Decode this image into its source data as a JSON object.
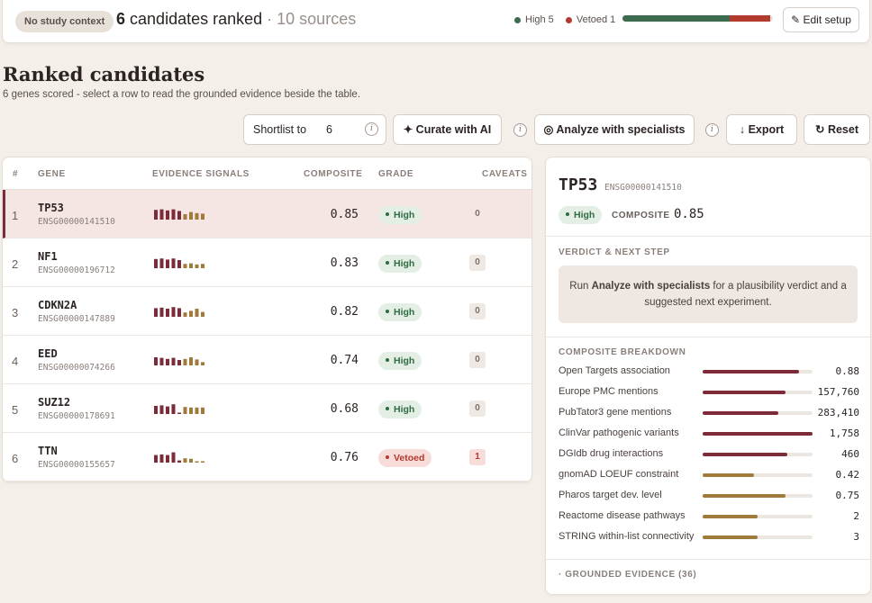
{
  "header": {
    "context_badge": "No study context",
    "ranked_count": "6",
    "ranked_text": "candidates ranked",
    "sources_text": "· 10 sources",
    "legend_high": "High 5",
    "legend_vetoed": "Vetoed 1",
    "high_count": 5,
    "vetoed_count": 1,
    "edit_label": "✎ Edit setup",
    "colors": {
      "high": "#3d6b4f",
      "vetoed": "#b23a2e"
    }
  },
  "page": {
    "title": "Ranked candidates",
    "subtitle": "6 genes scored - select a row to read the grounded evidence beside the table."
  },
  "toolbar": {
    "shortlist_label": "Shortlist to",
    "shortlist_value": "6",
    "curate_label": "✦ Curate with AI",
    "analyze_label": "◎ Analyze with specialists",
    "export_label": "↓ Export",
    "reset_label": "↻ Reset",
    "info_glyph": "i"
  },
  "table": {
    "headers": {
      "num": "#",
      "gene": "GENE",
      "signals": "EVIDENCE SIGNALS",
      "composite": "COMPOSITE",
      "grade": "GRADE",
      "caveats": "CAVEATS"
    },
    "rows": [
      {
        "num": "1",
        "gene": "TP53",
        "ens": "ENSG00000141510",
        "composite": "0.85",
        "grade": "High",
        "caveats": "0",
        "selected": true,
        "signals": [
          0.9,
          0.95,
          0.85,
          0.95,
          0.8,
          0.5,
          0.7,
          0.6,
          0.55
        ]
      },
      {
        "num": "2",
        "gene": "NF1",
        "ens": "ENSG00000196712",
        "composite": "0.83",
        "grade": "High",
        "caveats": "0",
        "selected": false,
        "signals": [
          0.85,
          0.9,
          0.8,
          0.9,
          0.75,
          0.4,
          0.45,
          0.35,
          0.4
        ]
      },
      {
        "num": "3",
        "gene": "CDKN2A",
        "ens": "ENSG00000147889",
        "composite": "0.82",
        "grade": "High",
        "caveats": "0",
        "selected": false,
        "signals": [
          0.8,
          0.85,
          0.75,
          0.9,
          0.8,
          0.4,
          0.55,
          0.75,
          0.45
        ]
      },
      {
        "num": "4",
        "gene": "EED",
        "ens": "ENSG00000074266",
        "composite": "0.74",
        "grade": "High",
        "caveats": "0",
        "selected": false,
        "signals": [
          0.75,
          0.7,
          0.6,
          0.7,
          0.5,
          0.6,
          0.75,
          0.55,
          0.3
        ]
      },
      {
        "num": "5",
        "gene": "SUZ12",
        "ens": "ENSG00000178691",
        "composite": "0.68",
        "grade": "High",
        "caveats": "0",
        "selected": false,
        "signals": [
          0.75,
          0.8,
          0.7,
          0.9,
          0.1,
          0.65,
          0.6,
          0.6,
          0.6
        ]
      },
      {
        "num": "6",
        "gene": "TTN",
        "ens": "ENSG00000155657",
        "composite": "0.76",
        "grade": "Vetoed",
        "caveats": "1",
        "selected": false,
        "signals": [
          0.7,
          0.75,
          0.7,
          0.95,
          0.2,
          0.4,
          0.35,
          0.12,
          0.12
        ]
      }
    ],
    "signal_colors": [
      "#7e2b39",
      "#7e2b39",
      "#7e2b39",
      "#7e2b39",
      "#7e2b39",
      "#a07a3a",
      "#a07a3a",
      "#a07a3a",
      "#a07a3a"
    ]
  },
  "detail": {
    "gene": "TP53",
    "ens": "ENSG00000141510",
    "grade": "High",
    "composite_label": "COMPOSITE",
    "composite_value": "0.85",
    "verdict_heading": "VERDICT & NEXT STEP",
    "verdict_pre": "Run ",
    "verdict_bold": "Analyze with specialists",
    "verdict_post": " for a plausibility verdict and a suggested next experiment.",
    "breakdown_heading": "COMPOSITE BREAKDOWN",
    "breakdown": [
      {
        "label": "Open Targets association",
        "value": "0.88",
        "fill": 0.88,
        "color": "#7e2b39"
      },
      {
        "label": "Europe PMC mentions",
        "value": "157,760",
        "fill": 0.75,
        "color": "#7e2b39"
      },
      {
        "label": "PubTator3 gene mentions",
        "value": "283,410",
        "fill": 0.69,
        "color": "#7e2b39"
      },
      {
        "label": "ClinVar pathogenic variants",
        "value": "1,758",
        "fill": 1.0,
        "color": "#7e2b39"
      },
      {
        "label": "DGIdb drug interactions",
        "value": "460",
        "fill": 0.77,
        "color": "#7e2b39"
      },
      {
        "label": "gnomAD LOEUF constraint",
        "value": "0.42",
        "fill": 0.47,
        "color": "#a07a3a"
      },
      {
        "label": "Pharos target dev. level",
        "value": "0.75",
        "fill": 0.75,
        "color": "#a07a3a"
      },
      {
        "label": "Reactome disease pathways",
        "value": "2",
        "fill": 0.5,
        "color": "#a07a3a"
      },
      {
        "label": "STRING within-list connectivity",
        "value": "3",
        "fill": 0.5,
        "color": "#a07a3a"
      }
    ],
    "grounded_label": "· GROUNDED EVIDENCE (36)"
  }
}
